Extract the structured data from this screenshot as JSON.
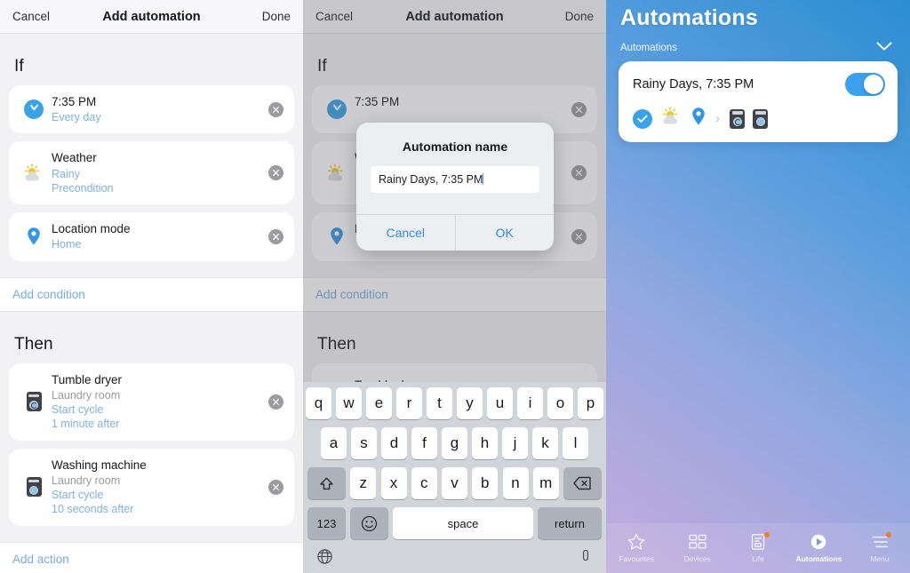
{
  "panel_left": {
    "navbar": {
      "cancel": "Cancel",
      "title": "Add automation",
      "done": "Done"
    },
    "if_section": {
      "heading": "If"
    },
    "if_items": [
      {
        "icon": "clock-icon",
        "title": "7:35 PM",
        "sub1": "Every day",
        "sub2": ""
      },
      {
        "icon": "weather-icon",
        "title": "Weather",
        "sub1": "Rainy",
        "sub2": "Precondition"
      },
      {
        "icon": "location-pin-icon",
        "title": "Location mode",
        "sub1": "Home",
        "sub2": ""
      }
    ],
    "add_condition": "Add condition",
    "then_section": {
      "heading": "Then"
    },
    "then_items": [
      {
        "icon": "tumble-dryer-icon",
        "title": "Tumble dryer",
        "room": "Laundry room",
        "action": "Start cycle",
        "delay": "1 minute after"
      },
      {
        "icon": "washing-machine-icon",
        "title": "Washing machine",
        "room": "Laundry room",
        "action": "Start cycle",
        "delay": "10 seconds after"
      }
    ],
    "add_action": "Add action"
  },
  "panel_middle": {
    "navbar": {
      "cancel": "Cancel",
      "title": "Add automation",
      "done": "Done"
    },
    "if_section": {
      "heading": "If"
    },
    "if_items": [
      {
        "title": "7:35 PM"
      },
      {
        "title": "Weather"
      },
      {
        "title": "Location mode"
      }
    ],
    "add_condition": "Add condition",
    "then_section": {
      "heading": "Then"
    },
    "then_first_item": "Tumble dryer",
    "dialog": {
      "title": "Automation name",
      "input_value": "Rainy Days, 7:35 PM",
      "input_placeholder": "Automation name",
      "cancel": "Cancel",
      "ok": "OK"
    },
    "keyboard": {
      "row1": [
        "q",
        "w",
        "e",
        "r",
        "t",
        "y",
        "u",
        "i",
        "o",
        "p"
      ],
      "row2": [
        "a",
        "s",
        "d",
        "f",
        "g",
        "h",
        "j",
        "k",
        "l"
      ],
      "row3": [
        "z",
        "x",
        "c",
        "v",
        "b",
        "n",
        "m"
      ],
      "shift": "shift-icon",
      "backspace": "backspace-icon",
      "numbers": "123",
      "emoji": "emoji-icon",
      "space": "space",
      "return": "return",
      "globe": "globe-icon"
    }
  },
  "panel_right": {
    "title": "Automations",
    "group_label": "Automations",
    "collapse_icon": "chevron-down-icon",
    "automation": {
      "name": "Rainy Days, 7:35 PM",
      "enabled": true,
      "trigger_icons": [
        "check-circle-icon",
        "weather-icon",
        "location-pin-icon"
      ],
      "separator": "›",
      "action_icons": [
        "tumble-dryer-icon",
        "washing-machine-icon"
      ]
    },
    "tabs": [
      {
        "label": "Favourites",
        "icon": "star-icon",
        "active": false,
        "badge": false
      },
      {
        "label": "Devices",
        "icon": "grid-icon",
        "active": false,
        "badge": false
      },
      {
        "label": "Life",
        "icon": "life-document-icon",
        "active": false,
        "badge": true
      },
      {
        "label": "Automations",
        "icon": "play-circle-icon",
        "active": true,
        "badge": false
      },
      {
        "label": "Menu",
        "icon": "hamburger-menu-icon",
        "active": false,
        "badge": true
      }
    ]
  },
  "colors": {
    "accent_blue": "#3aa3e8",
    "link_blue": "#76ace0",
    "dialog_action_blue": "#2f8cf0",
    "toggle_on": "#3ba0ed",
    "badge_orange": "#f07c28",
    "appliance_dark": "#3f4349"
  }
}
